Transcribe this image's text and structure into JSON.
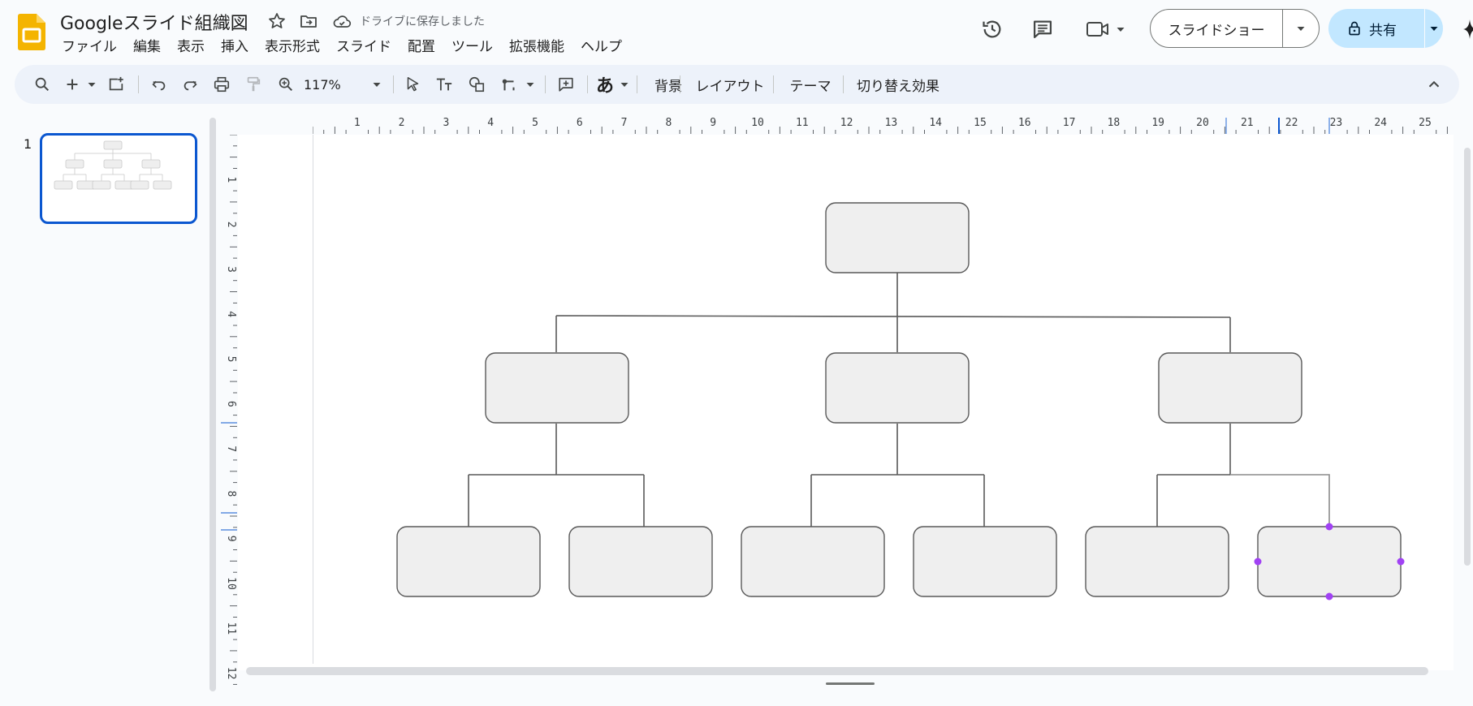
{
  "header": {
    "title": "Googleスライド組織図",
    "save_status": "ドライブに保存しました"
  },
  "menu": {
    "items": [
      "ファイル",
      "編集",
      "表示",
      "挿入",
      "表示形式",
      "スライド",
      "配置",
      "ツール",
      "拡張機能",
      "ヘルプ"
    ]
  },
  "actions": {
    "slideshow_label": "スライドショー",
    "share_label": "共有"
  },
  "toolbar": {
    "zoom": "117%",
    "background_label": "背景",
    "layout_label": "レイアウト",
    "theme_label": "テーマ",
    "transition_label": "切り替え効果",
    "input_tool_glyph": "あ"
  },
  "filmstrip": {
    "slide_number": "1"
  },
  "rulers": {
    "horizontal_labels": [
      "1",
      "2",
      "3",
      "4",
      "5",
      "6",
      "7",
      "8",
      "9",
      "10",
      "11",
      "12",
      "13",
      "14",
      "15",
      "16",
      "17",
      "18",
      "19",
      "20",
      "21",
      "22",
      "23",
      "24",
      "25"
    ],
    "vertical_labels": [
      "1",
      "2",
      "3",
      "4",
      "5",
      "6",
      "7",
      "8",
      "9",
      "10",
      "11",
      "12"
    ]
  },
  "org_chart": {
    "levels": [
      1,
      3,
      6
    ],
    "box_fill": "#efefef",
    "box_stroke": "#595959",
    "selection_color": "#a142f4",
    "selected_box": "level-3-box-6"
  },
  "colors": {
    "accent": "#0b57d0",
    "share_bg": "#c2e7ff",
    "toolbar_bg": "#edf2fa",
    "app_yellow": "#f4b400"
  }
}
